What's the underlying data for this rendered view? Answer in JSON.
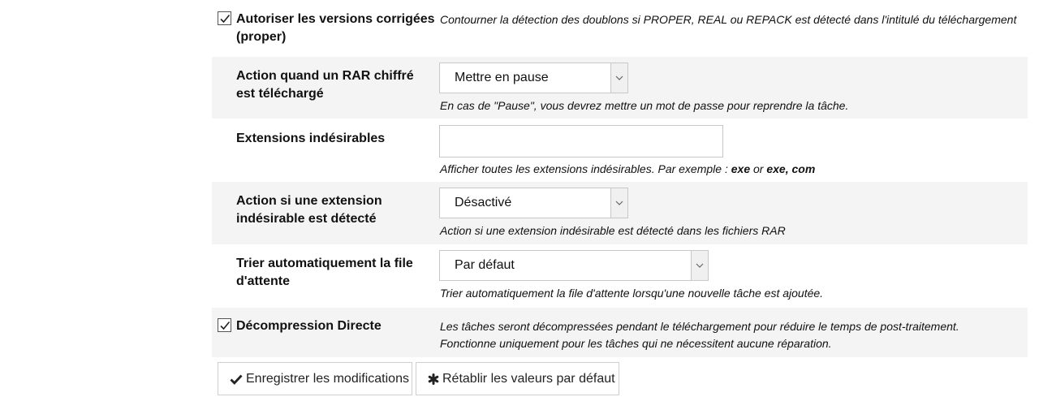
{
  "settings": {
    "proper": {
      "label": "Autoriser les versions corrigées (proper)",
      "checked": true,
      "description": "Contourner la détection des doublons si PROPER, REAL ou REPACK est détecté dans l'intitulé du téléchargement"
    },
    "encrypted_rar": {
      "label": "Action quand un RAR chiffré est téléchargé",
      "selected": "Mettre en pause",
      "description": "En cas de \"Pause\", vous devrez mettre un mot de passe pour reprendre la tâche."
    },
    "unwanted_ext": {
      "label": "Extensions indésirables",
      "value": "",
      "description_prefix": "Afficher toutes les extensions indésirables. Par exemple : ",
      "example1": "exe",
      "or": " or ",
      "example2": "exe, com"
    },
    "unwanted_ext_action": {
      "label": "Action si une extension indésirable est détecté",
      "selected": "Désactivé",
      "description": "Action si une extension indésirable est détecté dans les fichiers RAR"
    },
    "auto_sort": {
      "label": "Trier automatiquement la file d'attente",
      "selected": "Par défaut",
      "description": "Trier automatiquement la file d'attente lorsqu'une nouvelle tâche est ajoutée."
    },
    "direct_unpack": {
      "label": "Décompression Directe",
      "checked": true,
      "description_line1": "Les tâches seront décompressées pendant le téléchargement pour réduire le temps de post-traitement.",
      "description_line2": "Fonctionne uniquement pour les tâches qui ne nécessitent aucune réparation."
    }
  },
  "buttons": {
    "save": {
      "label": "Enregistrer les modifications",
      "icon": "checkmark-icon"
    },
    "reset": {
      "label": "Rétablir les valeurs par défaut",
      "icon": "asterisk-icon"
    }
  }
}
